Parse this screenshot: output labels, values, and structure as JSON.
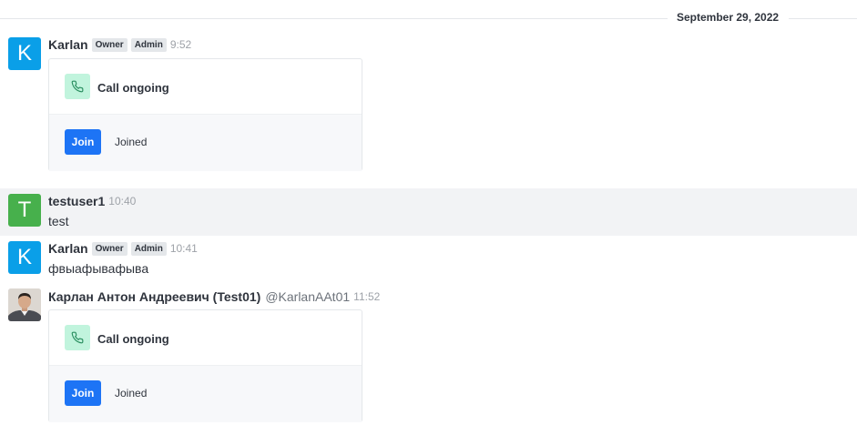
{
  "date_divider": "September 29, 2022",
  "messages": [
    {
      "avatar_letter": "K",
      "name": "Karlan",
      "badges": [
        "Owner",
        "Admin"
      ],
      "time": "9:52",
      "call": {
        "title": "Call ongoing",
        "join_label": "Join",
        "status": "Joined"
      }
    },
    {
      "avatar_letter": "T",
      "name": "testuser1",
      "time": "10:40",
      "text": "test"
    },
    {
      "avatar_letter": "K",
      "name": "Karlan",
      "badges": [
        "Owner",
        "Admin"
      ],
      "time": "10:41",
      "text": "фвыафывафыва"
    },
    {
      "name": "Карлан Антон Андреевич (Test01)",
      "username": "@KarlanAAt01",
      "time": "11:52",
      "call": {
        "title": "Call ongoing",
        "join_label": "Join",
        "status": "Joined"
      }
    }
  ],
  "colors": {
    "avatar_k": "#0a9fe8",
    "avatar_t": "#47b04c",
    "join_button": "#1d74f5",
    "phone_tile": "#c1f4dd"
  },
  "icons": {
    "call": "phone-icon"
  }
}
